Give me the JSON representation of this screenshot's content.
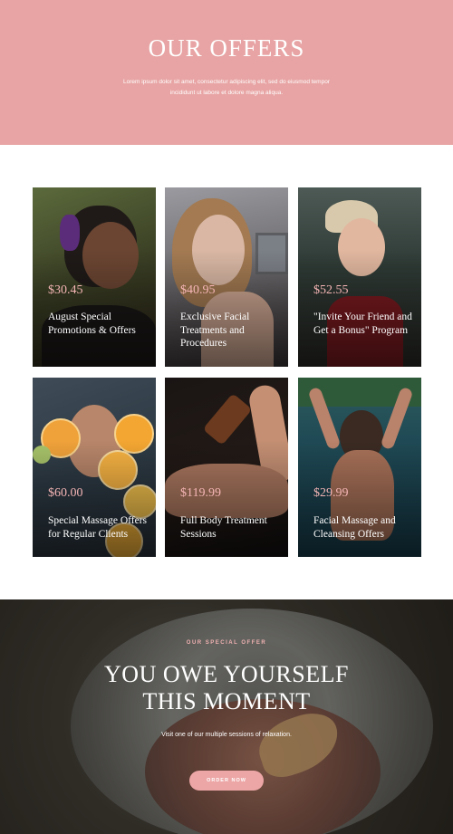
{
  "hero": {
    "title": "OUR OFFERS",
    "description": "Lorem ipsum dolor sit amet, consectetur adipiscing elit, sed do eiusmod tempor incididunt ut labore et dolore magna aliqua.",
    "background_color": "#e8a4a4"
  },
  "offers": [
    {
      "price": "$30.45",
      "title": "August Special Promotions & Offers"
    },
    {
      "price": "$40.95",
      "title": "Exclusive Facial Treatments and Procedures"
    },
    {
      "price": "$52.55",
      "title": "\"Invite Your Friend and Get a Bonus\" Program"
    },
    {
      "price": "$60.00",
      "title": "Special Massage Offers for Regular Clients"
    },
    {
      "price": "$119.99",
      "title": "Full Body Treatment Sessions"
    },
    {
      "price": "$29.99",
      "title": "Facial Massage and Cleansing Offers"
    }
  ],
  "special": {
    "kicker": "OUR SPECIAL OFFER",
    "headline_line1": "YOU OWE YOURSELF",
    "headline_line2": "THIS MOMENT",
    "subtext": "Visit one of our multiple sessions of relaxation.",
    "button_label": "ORDER NOW",
    "accent_color": "#eda6a6"
  }
}
